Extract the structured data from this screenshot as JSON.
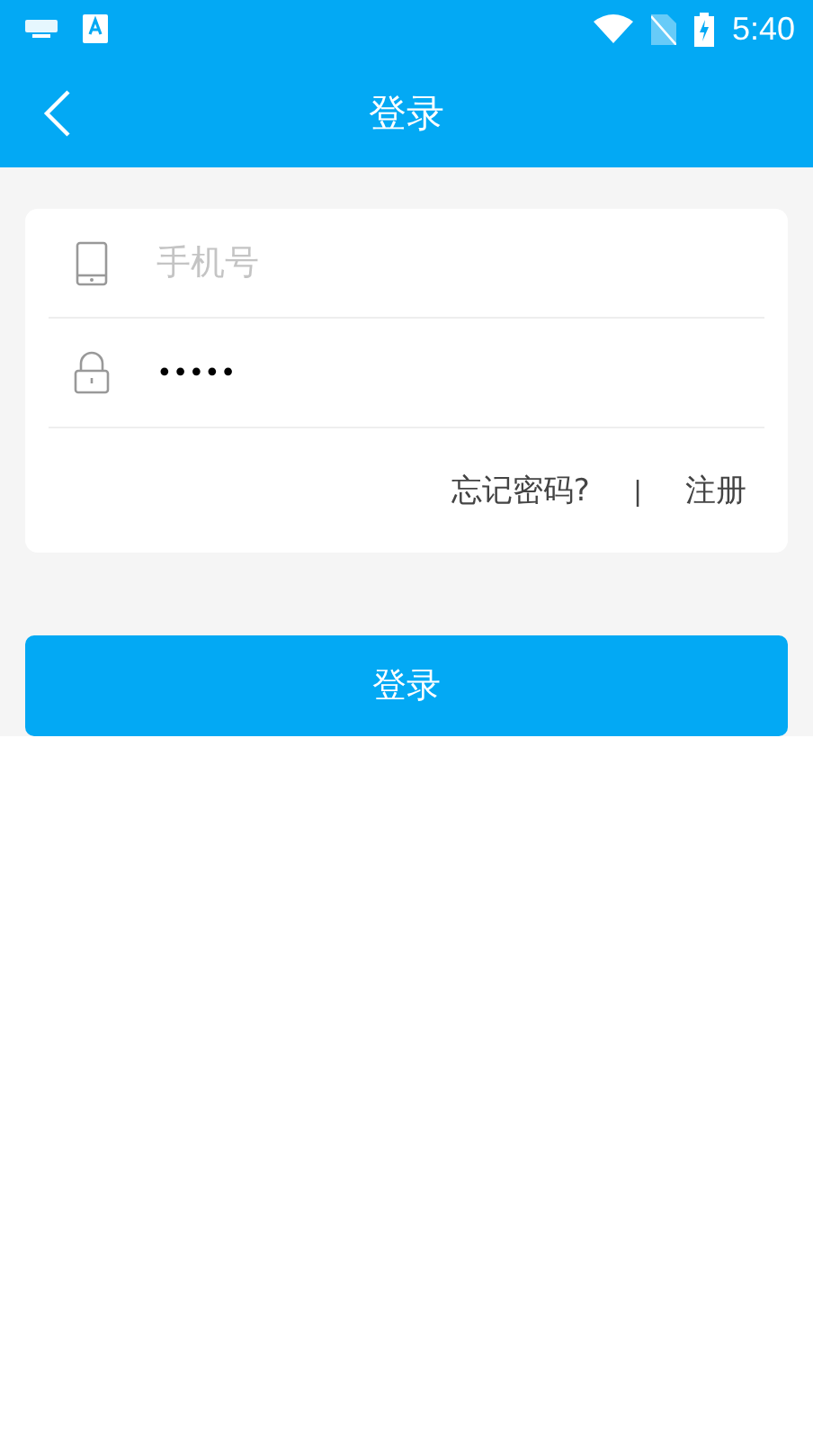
{
  "status_bar": {
    "time": "5:40"
  },
  "header": {
    "title": "登录"
  },
  "form": {
    "phone": {
      "placeholder": "手机号"
    },
    "password": {
      "value": "•••••"
    },
    "forgot_link": "忘记密码?",
    "separator": "|",
    "register_link": "注册"
  },
  "login_button": "登录"
}
